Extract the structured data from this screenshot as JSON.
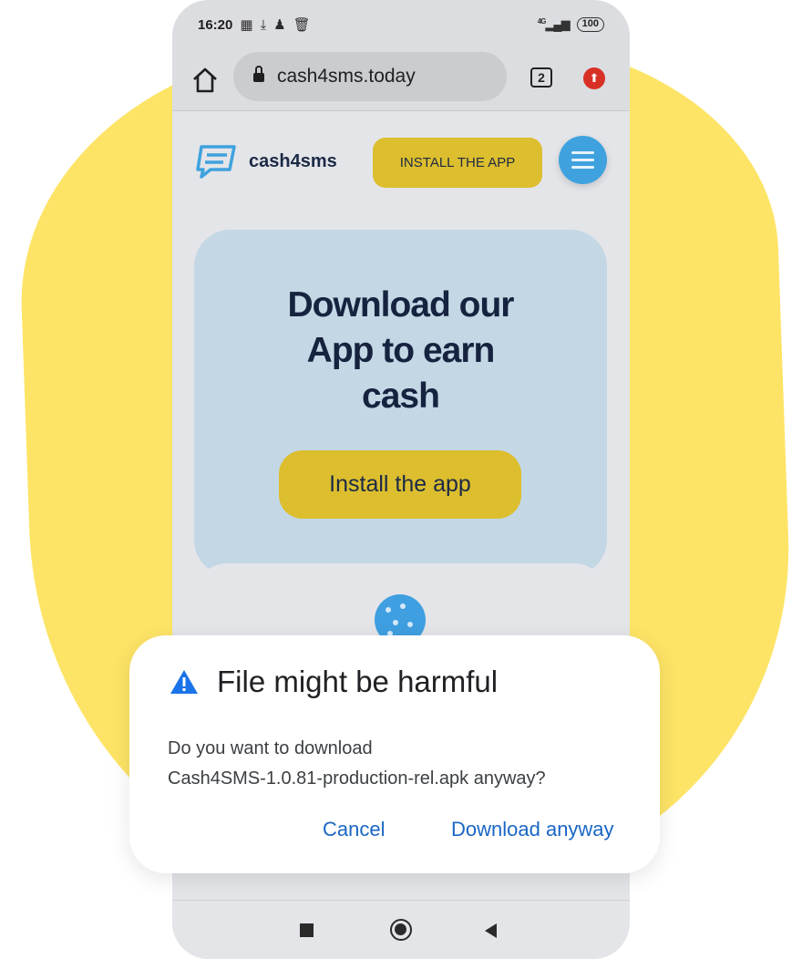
{
  "status_bar": {
    "time": "16:20",
    "network": "4G",
    "battery": "100"
  },
  "browser": {
    "url": "cash4sms.today",
    "tab_count": "2"
  },
  "site": {
    "logo_text": "cash4sms",
    "header_button": "INSTALL THE APP",
    "hero_title_lines": [
      "Download our",
      "App to earn",
      "cash"
    ],
    "hero_button": "Install the app"
  },
  "dialog": {
    "title": "File might be harmful",
    "body_line1": "Do you want to download",
    "body_line2": "Cash4SMS-1.0.81-production-rel.apk anyway?",
    "cancel_label": "Cancel",
    "confirm_label": "Download anyway"
  },
  "colors": {
    "background_blob": "#fde466",
    "accent_yellow": "#dcbe2e",
    "accent_blue": "#3fa2de",
    "link_blue": "#1a66c4",
    "warning_blue": "#1a73e8",
    "navy_text": "#16233f"
  },
  "icons": {
    "status": [
      "qr-icon",
      "download-icon",
      "person-icon",
      "trash-icon"
    ],
    "browser": [
      "home-icon",
      "lock-icon",
      "update-icon"
    ],
    "nav": [
      "recents-icon",
      "home-icon",
      "back-icon"
    ]
  }
}
